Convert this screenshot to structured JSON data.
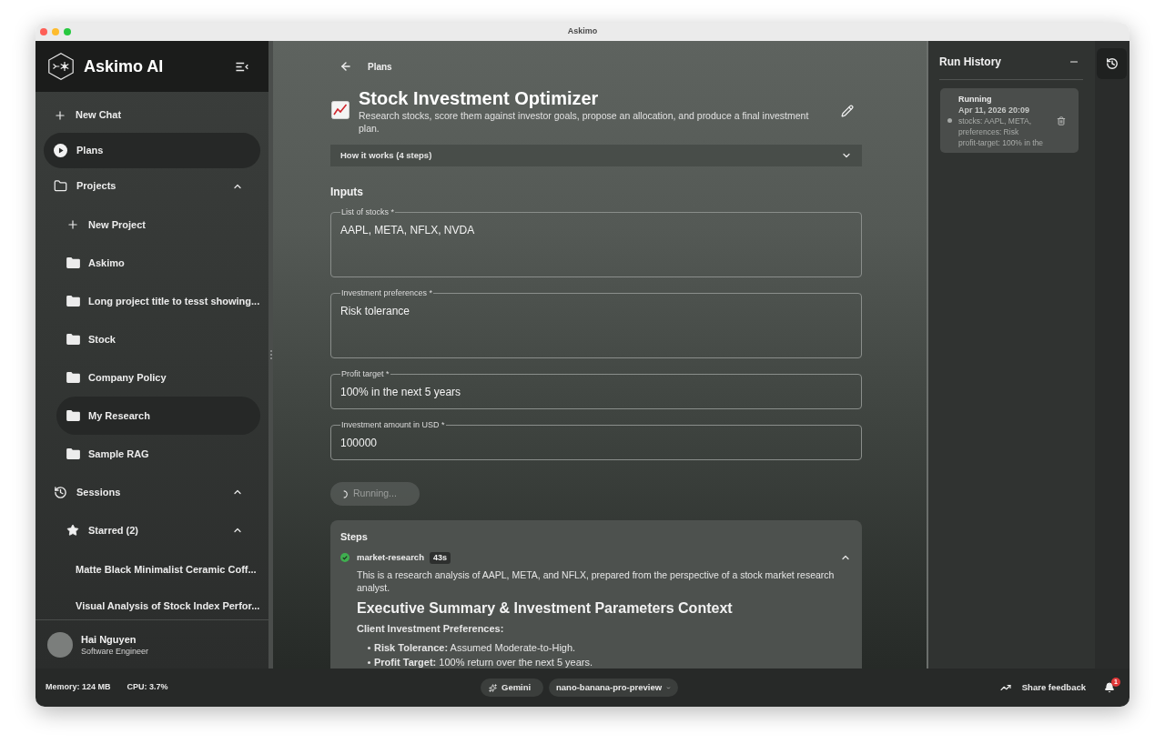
{
  "window": {
    "title": "Askimo"
  },
  "sidebar": {
    "brand": "Askimo AI",
    "nav": [
      {
        "label": "New Chat",
        "kind": "new",
        "selected": false
      },
      {
        "label": "Plans",
        "kind": "plans",
        "selected": true
      }
    ],
    "projects": {
      "label": "Projects",
      "expanded": true,
      "new_project": "New Project",
      "items": [
        {
          "label": "Askimo",
          "selected": false
        },
        {
          "label": "Long project title to tesst showing...",
          "selected": false
        },
        {
          "label": "Stock",
          "selected": false
        },
        {
          "label": "Company Policy",
          "selected": false
        },
        {
          "label": "My Research",
          "selected": true
        },
        {
          "label": "Sample RAG",
          "selected": false
        }
      ]
    },
    "sessions": {
      "label": "Sessions",
      "expanded": true,
      "starred": {
        "label": "Starred (2)",
        "expanded": true,
        "items": [
          {
            "label": "Matte Black Minimalist Ceramic Coff..."
          },
          {
            "label": "Visual Analysis of Stock Index Perfor..."
          }
        ]
      }
    },
    "user": {
      "name": "Hai Nguyen",
      "role": "Software Engineer"
    }
  },
  "plan": {
    "back_label": "Plans",
    "title": "Stock Investment Optimizer",
    "description": "Research stocks, score them against investor goals, propose an allocation, and produce a final investment plan.",
    "how_it_works": {
      "label": "How it works (4 steps)",
      "expanded": false
    },
    "inputs_heading": "Inputs",
    "inputs": [
      {
        "label": "List of stocks *",
        "value": "AAPL, META, NFLX, NVDA",
        "kind": "multiline"
      },
      {
        "label": "Investment preferences *",
        "value": "Risk tolerance",
        "kind": "multiline"
      },
      {
        "label": "Profit target *",
        "value": "100% in the next 5 years",
        "kind": "single"
      },
      {
        "label": "Investment amount in USD *",
        "value": "100000",
        "kind": "single"
      }
    ],
    "run_button": {
      "label": "Running...",
      "disabled": true
    },
    "steps": {
      "heading": "Steps",
      "items": [
        {
          "name": "market-research",
          "duration": "43s",
          "done": true,
          "expanded": true,
          "intro": "This is a research analysis of AAPL, META, and NFLX, prepared from the perspective of a stock market research analyst.",
          "heading": "Executive Summary & Investment Parameters Context",
          "subheading": "Client Investment Preferences:",
          "bullets": [
            "**Risk Tolerance:** Assumed Moderate-to-High.",
            "**Profit Target:** 100% return over the next 5 years."
          ]
        }
      ]
    }
  },
  "run_history": {
    "title": "Run History",
    "runs": [
      {
        "status": "Running",
        "time": "Apr 11, 2026 20:09",
        "summary": [
          "stocks: AAPL, META,",
          "preferences: Risk",
          "profit-target: 100% in the"
        ]
      }
    ]
  },
  "status_bar": {
    "memory": "Memory: 124 MB",
    "cpu": "CPU: 3.7%",
    "provider": "Gemini",
    "model": "nano-banana-pro-preview",
    "feedback": "Share feedback",
    "notification_count": "1"
  }
}
